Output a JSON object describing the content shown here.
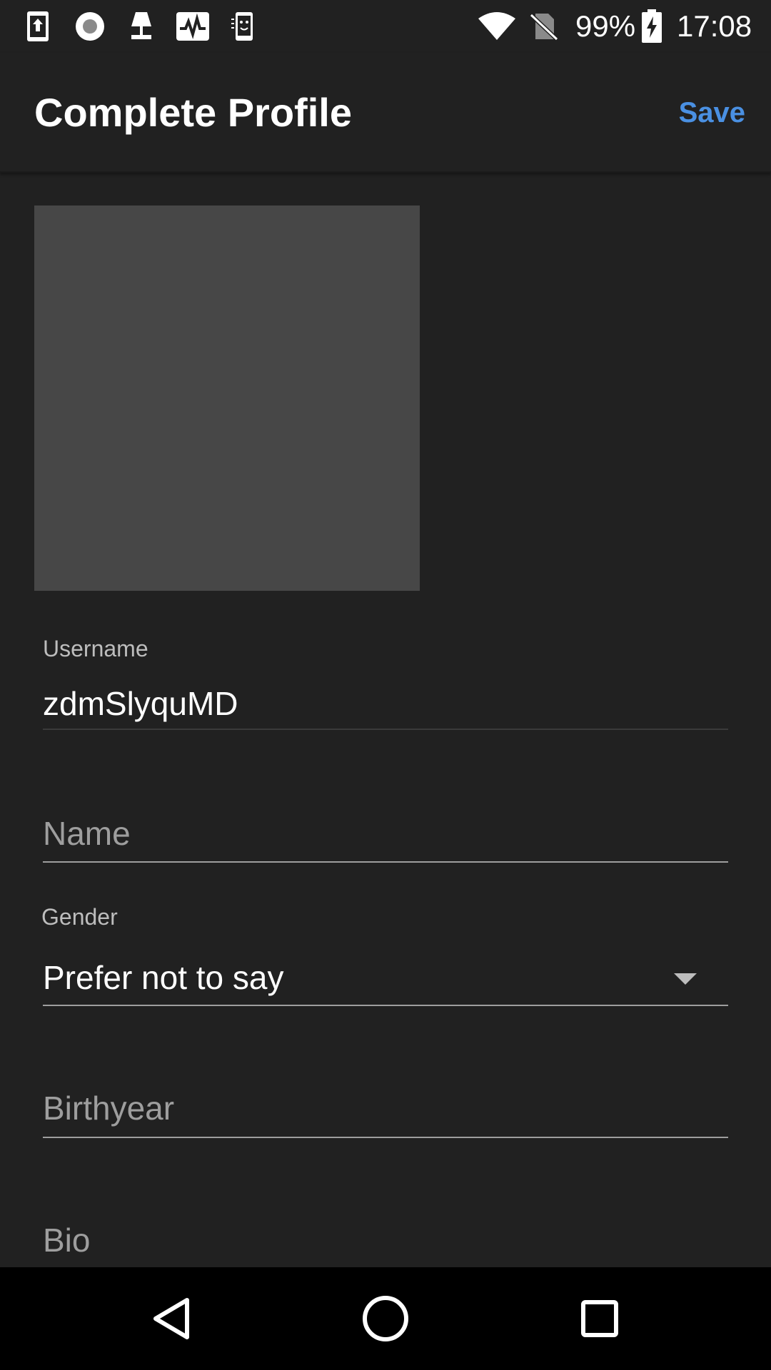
{
  "status_bar": {
    "icons": [
      "upload-icon",
      "record-icon",
      "lamp-icon",
      "activity-icon",
      "phone-face-icon",
      "wifi-icon",
      "no-sim-icon",
      "battery-charging-icon"
    ],
    "battery": "99%",
    "time": "17:08"
  },
  "app_bar": {
    "title": "Complete Profile",
    "save_label": "Save",
    "accent_color": "#4a90e2"
  },
  "avatar": {
    "color": "#474747"
  },
  "form": {
    "username": {
      "label": "Username",
      "value": "zdmSlyquMD"
    },
    "name": {
      "placeholder": "Name"
    },
    "gender": {
      "label": "Gender",
      "value": "Prefer not to say"
    },
    "birthyear": {
      "placeholder": "Birthyear"
    },
    "bio": {
      "placeholder": "Bio"
    }
  },
  "nav_bar": {
    "buttons": [
      "back-icon",
      "home-icon",
      "recents-icon"
    ]
  }
}
